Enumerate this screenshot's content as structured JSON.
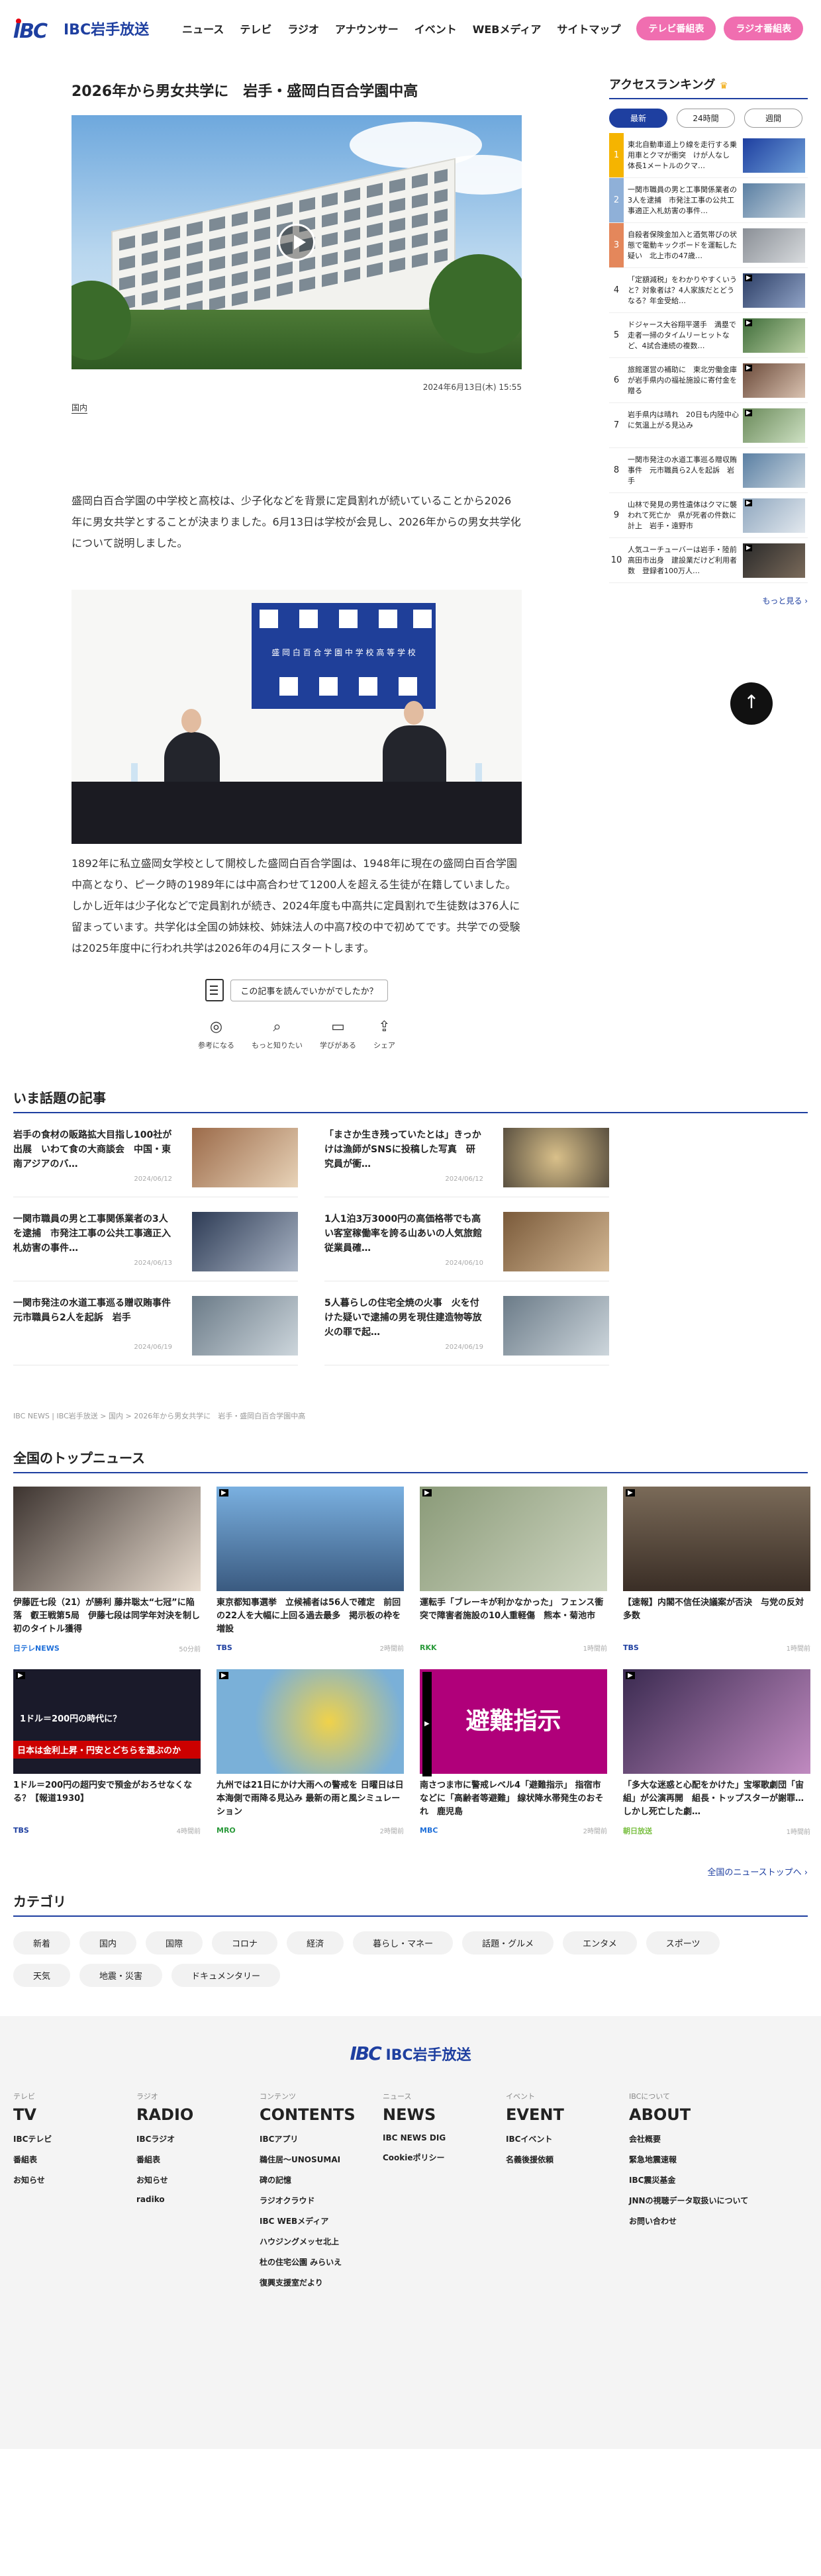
{
  "header": {
    "logo": "IBC岩手放送",
    "nav": [
      "ニュース",
      "テレビ",
      "ラジオ",
      "アナウンサー",
      "イベント",
      "WEBメディア",
      "サイトマップ"
    ],
    "tv_button": "テレビ番組表",
    "radio_button": "ラジオ番組表"
  },
  "article": {
    "title": "2026年から男女共学に　岩手・盛岡白百合学園中高",
    "date": "2024年6月13日(木) 15:55",
    "category": "国内",
    "para1": "盛岡白百合学園の中学校と高校は、少子化などを背景に定員割れが続いていることから2026年に男女共学とすることが決まりました。6月13日は学校が会見し、2026年からの男女共学化について説明しました。",
    "panel_text": "盛 岡 白 百 合 学 園 中 学 校 高 等 学 校",
    "para2": "1892年に私立盛岡女学校として開校した盛岡白百合学園は、1948年に現在の盛岡白百合学園中高となり、ピーク時の1989年には中高合わせて1200人を超える生徒が在籍していました。しかし近年は少子化などで定員割れが続き、2024年度も中高共に定員割れで生徒数は376人に留まっています。共学化は全国の姉妹校、姉妹法人の中高7校の中で初めてです。共学での受験は2025年度中に行われ共学は2026年の4月にスタートします。",
    "reaction_prompt": "この記事を読んでいかがでしたか？",
    "reactions": [
      "参考になる",
      "もっと知りたい",
      "学びがある",
      "シェア"
    ]
  },
  "ranking": {
    "title": "アクセスランキング",
    "tabs": [
      "最新",
      "24時間",
      "週間"
    ],
    "items": [
      {
        "num": "1",
        "text": "東北自動車道上り線を走行する乗用車とクマが衝突　けが人なし　体長1メートルのクマ…"
      },
      {
        "num": "2",
        "text": "一関市職員の男と工事関係業者の3人を逮捕　市発注工事の公共工事適正入札妨害の事件…"
      },
      {
        "num": "3",
        "text": "自殺者保険金加入と酒気帯びの状態で電動キックボードを運転した疑い　北上市の47歳…"
      },
      {
        "num": "4",
        "text": "「定額減税」をわかりやすくいうと？対象者は？4人家族だとどうなる？年金受給…"
      },
      {
        "num": "5",
        "text": "ドジャース大谷翔平選手　満塁で走者一掃のタイムリーヒットなど、4試合連続の複数…"
      },
      {
        "num": "6",
        "text": "旅館運営の補助に　東北労働金庫が岩手県内の福祉施設に寄付金を贈る"
      },
      {
        "num": "7",
        "text": "岩手県内は晴れ　20日も内陸中心に気温上がる見込み"
      },
      {
        "num": "8",
        "text": "一関市発注の水道工事巡る贈収賄事件　元市職員ら2人を起訴　岩手"
      },
      {
        "num": "9",
        "text": "山林で発見の男性遺体はクマに襲われて死亡か　県が死者の件数に計上　岩手・遠野市"
      },
      {
        "num": "10",
        "text": "人気ユーチューバーは岩手・陸前高田市出身　建設業だけど利用者数　登録者100万人…"
      }
    ],
    "more": "もっと見る ›"
  },
  "topics": {
    "title": "いま話題の記事",
    "items": [
      {
        "title": "岩手の食材の販路拡大目指し100社が出展　いわて食の大商談会　中国・東南アジアのバ…",
        "date": "2024/06/12"
      },
      {
        "title": "「まさか生き残っていたとは」きっかけは漁師がSNSに投稿した写真　研究員が衝…",
        "date": "2024/06/12"
      },
      {
        "title": "一関市職員の男と工事関係業者の3人を逮捕　市発注工事の公共工事適正入札妨害の事件…",
        "date": "2024/06/13"
      },
      {
        "title": "1人1泊3万3000円の高価格帯でも高い客室稼働率を誇る山あいの人気旅館　従業員確…",
        "date": "2024/06/10"
      },
      {
        "title": "一関市発注の水道工事巡る贈収賄事件　元市職員ら2人を起訴　岩手",
        "date": "2024/06/19"
      },
      {
        "title": "5人暮らしの住宅全焼の火事　火を付けた疑いで逮捕の男を現住建造物等放火の罪で起…",
        "date": "2024/06/19"
      }
    ]
  },
  "breadcrumb": "IBC NEWS | IBC岩手放送 > 国内 > 2026年から男女共学に　岩手・盛岡白百合学園中高",
  "national": {
    "title": "全国のトップニュース",
    "items": [
      {
        "title": "伊藤匠七段（21）が勝利 藤井聡太“七冠”に陥落　叡王戦第5局　伊藤七段は同学年対決を制し初のタイトル獲得",
        "src": "日テレNEWS",
        "age": "50分前",
        "srccolor": "#1e6fd9"
      },
      {
        "title": "東京都知事選挙　立候補者は56人で確定　前回の22人を大幅に上回る過去最多　掲示板の枠を増設",
        "src": "TBS",
        "age": "2時間前",
        "srccolor": "#1e3fa0"
      },
      {
        "title": "運転手「ブレーキが利かなかった」 フェンス衝突で障害者施設の10人重軽傷　熊本・菊池市",
        "src": "RKK",
        "age": "1時間前",
        "srccolor": "#2b9a3b"
      },
      {
        "title": "【速報】内閣不信任決議案が否決　与党の反対多数",
        "src": "TBS",
        "age": "1時間前",
        "srccolor": "#1e3fa0"
      },
      {
        "title": "1ドル＝200円の超円安で預金がおろせなくなる？【報道1930】",
        "src": "TBS",
        "age": "4時間前",
        "srccolor": "#1e3fa0"
      },
      {
        "title": "九州では21日にかけ大雨への警戒を 日曜日は日本海側で雨降る見込み 最新の雨と風シミュレーション",
        "src": "MRO",
        "age": "2時間前",
        "srccolor": "#2b9a3b"
      },
      {
        "title": "南さつま市に警戒レベル4「避難指示」 指宿市などに「高齢者等避難」 線状降水帯発生のおそれ　鹿児島",
        "src": "MBC",
        "age": "2時間前",
        "srccolor": "#1e6fd9"
      },
      {
        "title": "「多大な迷惑と心配をかけた」宝塚歌劇団「宙組」が公演再開　組長・トップスターが謝罪…しかし死亡した劇…",
        "src": "朝日放送",
        "age": "1時間前",
        "srccolor": "#7bc043"
      }
    ],
    "img_text_1": "1ドル＝200円の時代に？",
    "img_text_2": "日本は金利上昇・円安とどちらを選ぶのか",
    "img_text_3": "避難指示",
    "more": "全国のニューストップへ ›"
  },
  "categories": {
    "title": "カテゴリ",
    "chips": [
      "新着",
      "国内",
      "国際",
      "コロナ",
      "経済",
      "暮らし・マネー",
      "話題・グルメ",
      "エンタメ",
      "スポーツ",
      "天気",
      "地震・災害",
      "ドキュメンタリー"
    ]
  },
  "footer": {
    "logo": "IBC岩手放送",
    "cols": [
      {
        "small": "テレビ",
        "big": "TV",
        "links": [
          "IBCテレビ",
          "番組表",
          "お知らせ"
        ]
      },
      {
        "small": "ラジオ",
        "big": "RADIO",
        "links": [
          "IBCラジオ",
          "番組表",
          "お知らせ",
          "radiko"
        ]
      },
      {
        "small": "コンテンツ",
        "big": "CONTENTS",
        "links": [
          "IBCアプリ",
          "鵜住居～UNOSUMAI",
          "碑の記憶",
          "ラジオクラウド",
          "IBC WEBメディア",
          "ハウジングメッセ北上",
          "杜の住宅公園 みらいえ",
          "復興支援室だより"
        ]
      },
      {
        "small": "ニュース",
        "big": "NEWS",
        "links": [
          "IBC NEWS DIG",
          "Cookieポリシー"
        ]
      },
      {
        "small": "イベント",
        "big": "EVENT",
        "links": [
          "IBCイベント",
          "名義後援依頼"
        ]
      },
      {
        "small": "IBCについて",
        "big": "ABOUT",
        "links": [
          "会社概要",
          "緊急地震速報",
          "IBC震災基金",
          "JNNの視聴データ取扱いについて",
          "お問い合わせ"
        ]
      }
    ]
  }
}
